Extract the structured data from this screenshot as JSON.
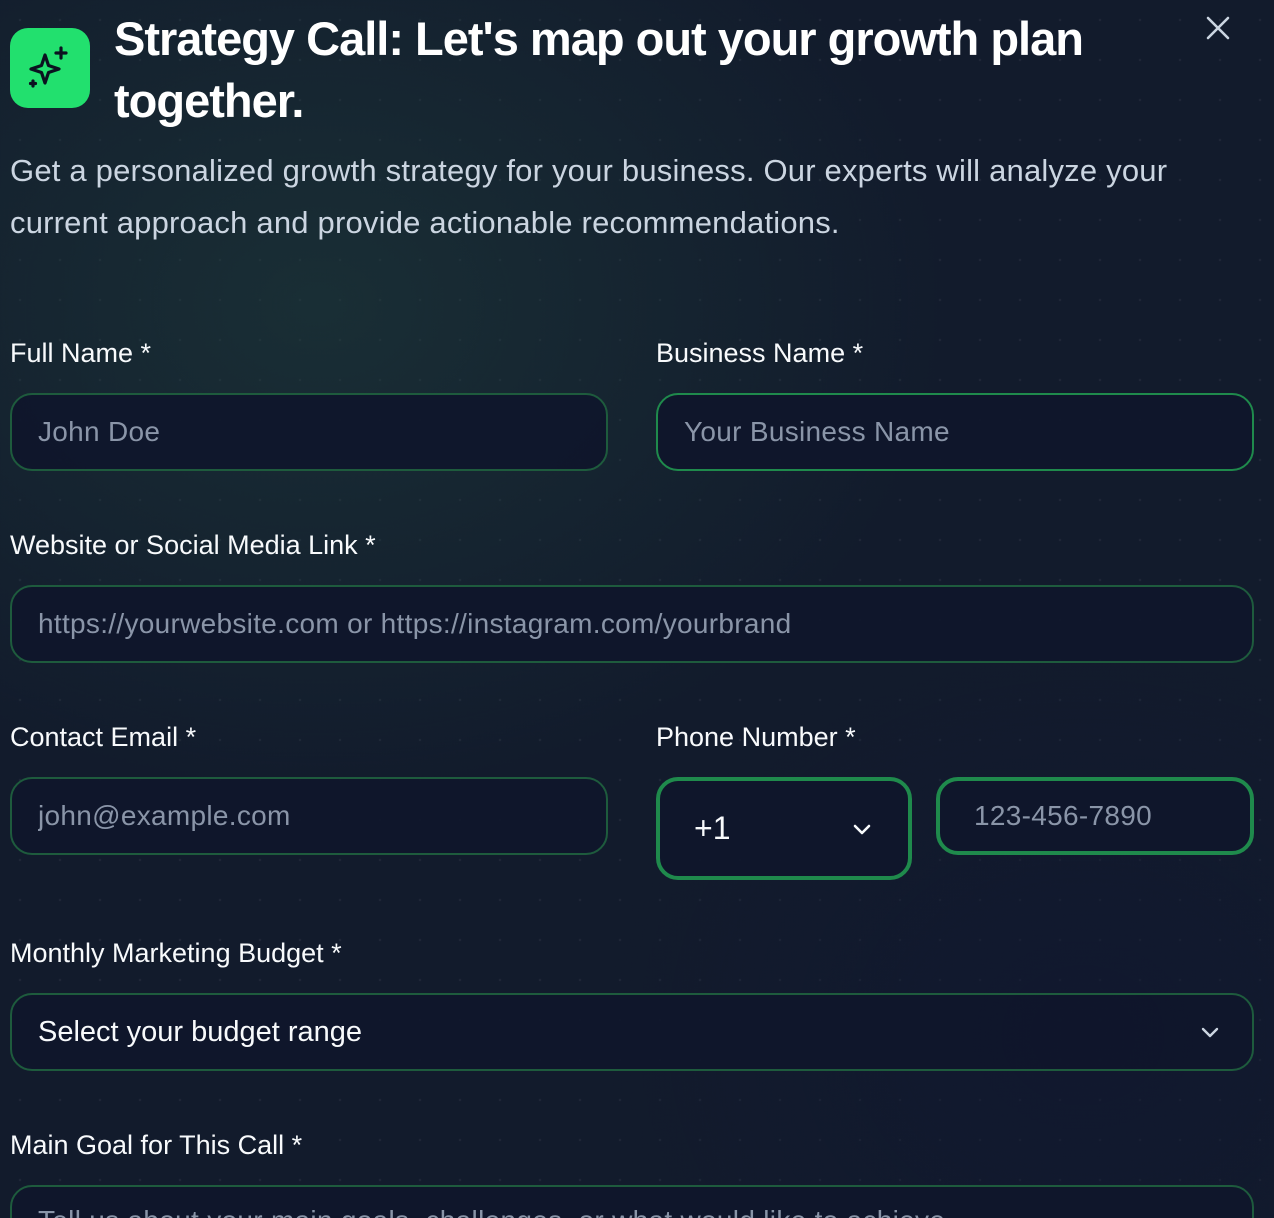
{
  "header": {
    "icon": "sparkles-icon",
    "title": "Strategy Call: Let's map out your growth plan together.",
    "subtitle": "Get a personalized growth strategy for your business. Our experts will analyze your current approach and provide actionable recommendations.",
    "close_icon": "close-icon"
  },
  "form": {
    "full_name": {
      "label": "Full Name *",
      "placeholder": "John Doe"
    },
    "business_name": {
      "label": "Business Name *",
      "placeholder": "Your Business Name"
    },
    "website": {
      "label": "Website or Social Media Link *",
      "placeholder": "https://yourwebsite.com or https://instagram.com/yourbrand"
    },
    "email": {
      "label": "Contact Email *",
      "placeholder": "john@example.com"
    },
    "phone": {
      "label": "Phone Number *",
      "country_code": "+1",
      "placeholder": "123-456-7890"
    },
    "budget": {
      "label": "Monthly Marketing Budget *",
      "selected": "Select your budget range"
    },
    "goal": {
      "label": "Main Goal for This Call *",
      "placeholder": "Tell us about your main goals, challenges, or what would like to achieve..."
    }
  },
  "colors": {
    "accent": "#22e06e",
    "field_border": "#1e5b3d",
    "background": "#121b2c"
  }
}
